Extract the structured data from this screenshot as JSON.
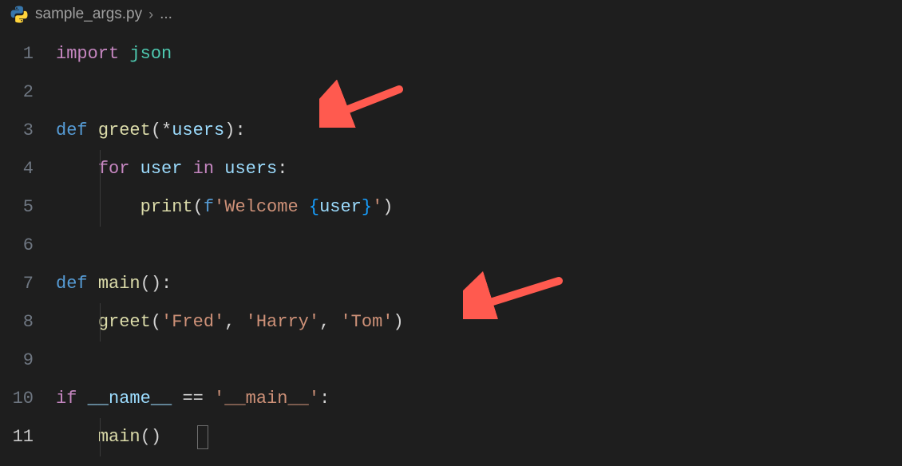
{
  "breadcrumb": {
    "filename": "sample_args.py",
    "separator": "›",
    "ellipsis": "..."
  },
  "lines": {
    "l1": {
      "num": "1",
      "kw": "import",
      "sp": " ",
      "mod": "json"
    },
    "l2": {
      "num": "2"
    },
    "l3": {
      "num": "3",
      "def": "def",
      "sp": " ",
      "fn": "greet",
      "lp": "(",
      "star": "*",
      "param": "users",
      "rp": ")",
      "colon": ":"
    },
    "l4": {
      "num": "4",
      "for": "for",
      "sp1": " ",
      "var": "user",
      "sp2": " ",
      "in": "in",
      "sp3": " ",
      "iter": "users",
      "colon": ":"
    },
    "l5": {
      "num": "5",
      "fn": "print",
      "lp": "(",
      "fpre": "f",
      "s1": "'Welcome ",
      "lb": "{",
      "fvar": "user",
      "rb": "}",
      "s2": "'",
      "rp": ")"
    },
    "l6": {
      "num": "6"
    },
    "l7": {
      "num": "7",
      "def": "def",
      "sp": " ",
      "fn": "main",
      "lp": "(",
      "rp": ")",
      "colon": ":"
    },
    "l8": {
      "num": "8",
      "fn": "greet",
      "lp": "(",
      "a1": "'Fred'",
      "c1": ", ",
      "a2": "'Harry'",
      "c2": ", ",
      "a3": "'Tom'",
      "rp": ")"
    },
    "l9": {
      "num": "9"
    },
    "l10": {
      "num": "10",
      "if": "if",
      "sp1": " ",
      "name": "__name__",
      "sp2": " ",
      "eq": "==",
      "sp3": " ",
      "main": "'__main__'",
      "colon": ":"
    },
    "l11": {
      "num": "11",
      "fn": "main",
      "lp": "(",
      "rp": ")"
    }
  },
  "arrows": {
    "a1": {
      "target": "line-3"
    },
    "a2": {
      "target": "line-8"
    }
  },
  "colors": {
    "arrow": "#ff5a4f",
    "bg": "#1e1e1e",
    "keyword_purple": "#c586c0",
    "keyword_blue": "#569cd6",
    "func": "#dcdcaa",
    "var": "#9cdcfe",
    "string": "#ce9178",
    "type": "#4ec9b0"
  }
}
